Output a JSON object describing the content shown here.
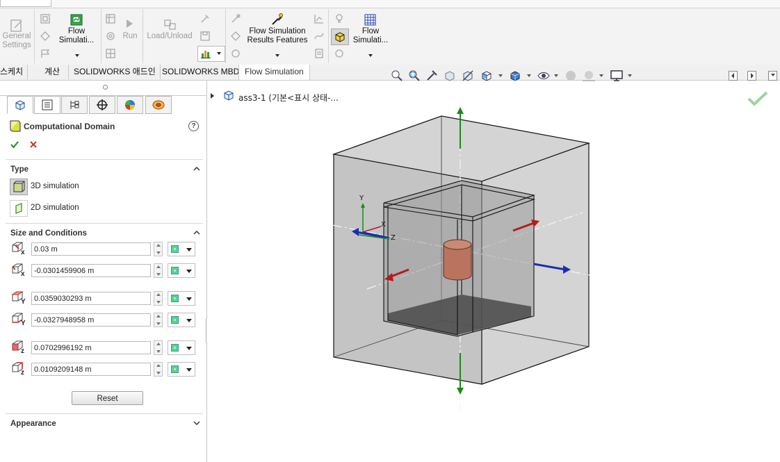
{
  "ribbon": {
    "general_settings": "General Settings",
    "flow_sim_1": "Flow Simulati...",
    "run": "Run",
    "load_unload": "Load/Unload",
    "results_features_1": "Flow Simulation",
    "results_features_2": "Results Features",
    "flow_sim_2_line1": "Flow",
    "flow_sim_2_line2": "Simulati...",
    "flow_sim_1_line1": "Flow",
    "flow_sim_1_line2": "Simulati..."
  },
  "tabs": [
    "스케치",
    "계산",
    "SOLIDWORKS 애드인",
    "SOLIDWORKS MBD",
    "Flow Simulation"
  ],
  "tree": {
    "root": "ass3-1  (기본<표시 상태-..."
  },
  "panel": {
    "title": "Computational Domain",
    "type_header": "Type",
    "type_3d": "3D simulation",
    "type_2d": "2D simulation",
    "size_header": "Size and Conditions",
    "fields": [
      {
        "axis": "x",
        "value": "0.03 m"
      },
      {
        "axis": "x",
        "value": "-0.0301459906 m"
      },
      {
        "axis": "Y",
        "value": "0.0359030293 m"
      },
      {
        "axis": "Y",
        "value": "-0.0327948958 m"
      },
      {
        "axis": "z",
        "value": "0.0702996192 m"
      },
      {
        "axis": "z",
        "value": "0.0109209148 m"
      }
    ],
    "reset": "Reset",
    "appearance_header": "Appearance"
  },
  "triad": {
    "x": "X",
    "y": "Y",
    "z": "Z"
  },
  "colors": {
    "accept": "#2a9a2a",
    "cancel": "#c0392b",
    "arrow_green": "#1a8a1a",
    "arrow_red": "#b51c1c",
    "arrow_blue": "#1b2fb0",
    "part": "#b9735e"
  }
}
